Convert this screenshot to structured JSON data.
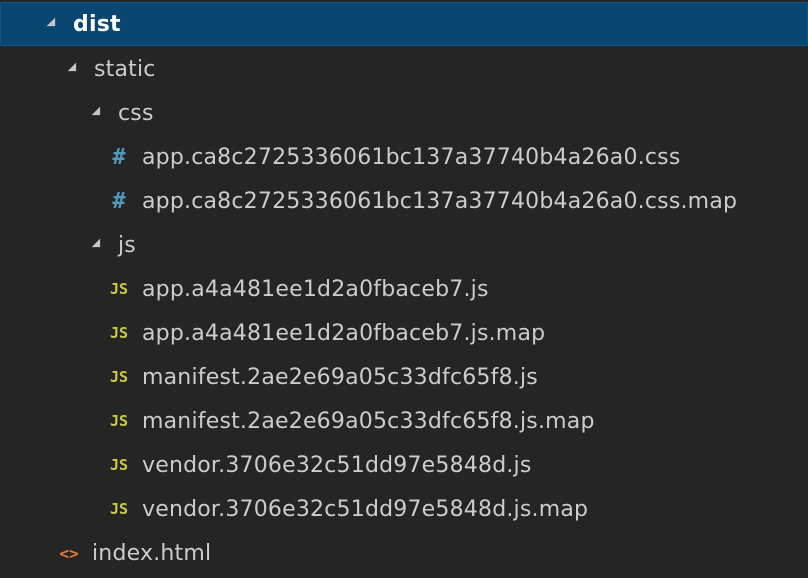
{
  "tree": {
    "dist": {
      "label": "dist",
      "icon": "chevron-down-icon",
      "selected": true
    },
    "static": {
      "label": "static",
      "icon": "chevron-down-icon"
    },
    "css": {
      "label": "css",
      "icon": "chevron-down-icon"
    },
    "css_files": [
      {
        "label": "app.ca8c2725336061bc137a37740b4a26a0.css",
        "icon_glyph": "#",
        "icon": "css-file-icon"
      },
      {
        "label": "app.ca8c2725336061bc137a37740b4a26a0.css.map",
        "icon_glyph": "#",
        "icon": "css-file-icon"
      }
    ],
    "js": {
      "label": "js",
      "icon": "chevron-down-icon"
    },
    "js_files": [
      {
        "label": "app.a4a481ee1d2a0fbaceb7.js",
        "icon_glyph": "JS",
        "icon": "js-file-icon"
      },
      {
        "label": "app.a4a481ee1d2a0fbaceb7.js.map",
        "icon_glyph": "JS",
        "icon": "js-file-icon"
      },
      {
        "label": "manifest.2ae2e69a05c33dfc65f8.js",
        "icon_glyph": "JS",
        "icon": "js-file-icon"
      },
      {
        "label": "manifest.2ae2e69a05c33dfc65f8.js.map",
        "icon_glyph": "JS",
        "icon": "js-file-icon"
      },
      {
        "label": "vendor.3706e32c51dd97e5848d.js",
        "icon_glyph": "JS",
        "icon": "js-file-icon"
      },
      {
        "label": "vendor.3706e32c51dd97e5848d.js.map",
        "icon_glyph": "JS",
        "icon": "js-file-icon"
      }
    ],
    "index": {
      "label": "index.html",
      "icon_glyph": "<>",
      "icon": "html-file-icon"
    }
  },
  "colors": {
    "background": "#252526",
    "selection": "#094771",
    "text": "#cccccc",
    "css_icon": "#519aba",
    "js_icon": "#cbcb41",
    "html_icon": "#e37933"
  }
}
